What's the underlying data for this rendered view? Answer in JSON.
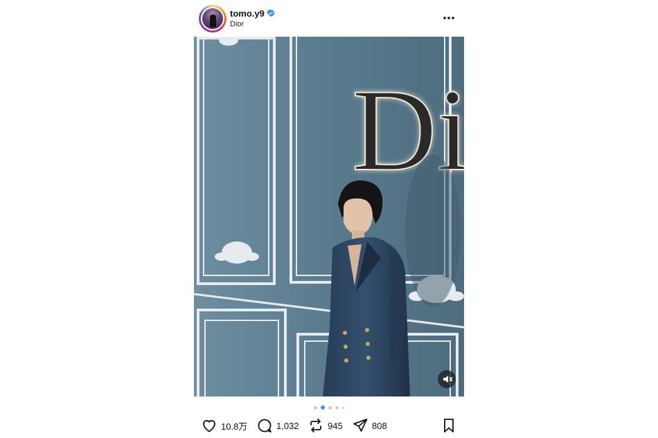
{
  "post": {
    "username": "tomo.y9",
    "subtitle": "Dior",
    "more_icon": "more-horizontal-icon",
    "verified_icon": "verified-badge-icon",
    "photo": {
      "sign_text": "Dior",
      "mute_icon": "volume-off-icon"
    },
    "carousel": {
      "total": 5,
      "active_index": 1
    },
    "actions": {
      "likes": "10.8万",
      "comments": "1,032",
      "reposts": "945",
      "shares": "808",
      "like_icon": "heart-icon",
      "comment_icon": "comment-icon",
      "repost_icon": "repost-icon",
      "share_icon": "send-icon",
      "save_icon": "bookmark-icon"
    }
  },
  "colors": {
    "accent": "#3897f0",
    "wall": "#5b7a8c",
    "molding": "#e8ecef"
  }
}
